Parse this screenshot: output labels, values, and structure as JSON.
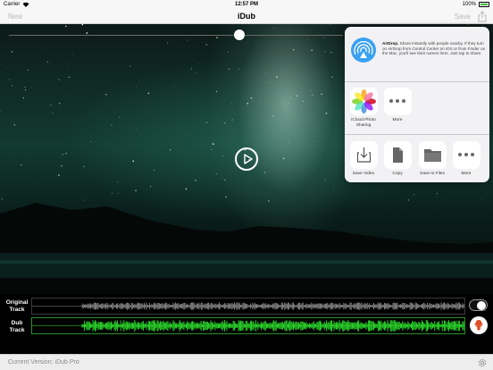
{
  "status_bar": {
    "carrier": "Carrier",
    "time": "12:57 PM",
    "battery": "100%",
    "wifi_icon": "wifi-icon",
    "battery_icon": "battery-icon"
  },
  "nav": {
    "left_button": "New",
    "title": "iDub",
    "right_button": "Save",
    "share_icon": "share-icon",
    "button_color": "#b9b9be"
  },
  "video": {
    "play_icon": "play-icon",
    "slider_progress": 0.7
  },
  "share_sheet": {
    "airdrop": {
      "title": "AirDrop.",
      "description": "Share instantly with people nearby. If they turn on AirDrop from Control Center on iOS or from Finder on the Mac, you'll see their names here. Just tap to share.",
      "icon": "airdrop-icon"
    },
    "apps": [
      {
        "label": "iCloud Photo Sharing",
        "icon": "photos-icon"
      },
      {
        "label": "More",
        "icon": "more-icon"
      }
    ],
    "actions": [
      {
        "label": "Save Video",
        "icon": "save-video-icon"
      },
      {
        "label": "Copy",
        "icon": "copy-icon"
      },
      {
        "label": "Save to Files",
        "icon": "folder-icon"
      },
      {
        "label": "More",
        "icon": "more-icon"
      }
    ]
  },
  "tracks": {
    "original_label": "Original Track",
    "dub_label": "Dub Track",
    "original_color": "#8a8a8a",
    "dub_color": "#2ee62e",
    "toggle_on": false,
    "mic_icon": "mic-icon"
  },
  "footer": {
    "version": "Current Version: iDub Pro",
    "settings_icon": "gear-icon"
  }
}
